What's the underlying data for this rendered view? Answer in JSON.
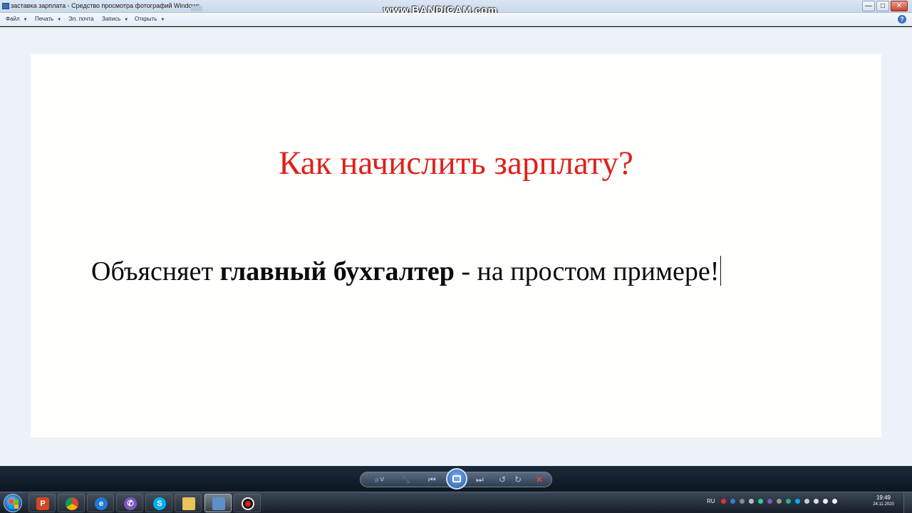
{
  "window": {
    "title": "заставка зарплата - Средство просмотра фотографий Windows",
    "controls": [
      "—",
      "□",
      "✕"
    ]
  },
  "overlay": {
    "watermark": "www.BANDICAM.com"
  },
  "menu": {
    "items": [
      {
        "label": "Файл",
        "has_dropdown": true
      },
      {
        "label": "Печать",
        "has_dropdown": true
      },
      {
        "label": "Эл. почта",
        "has_dropdown": false
      },
      {
        "label": "Запись",
        "has_dropdown": true
      },
      {
        "label": "Открыть",
        "has_dropdown": true
      }
    ],
    "help": "?"
  },
  "photo": {
    "title": "Как начислить зарплату?",
    "subtitle_start": "Объясняет ",
    "subtitle_bold": "главный бухгалтер",
    "subtitle_end": " - на простом примере!",
    "title_color": "#e0201b"
  },
  "viewer_controls": {
    "buttons": [
      "zoom-icon",
      "fit-icon",
      "previous-icon",
      "slideshow-icon",
      "next-icon",
      "rotate-left-icon",
      "rotate-right-icon",
      "delete-icon"
    ]
  },
  "taskbar": {
    "apps": [
      "powerpoint-icon",
      "chrome-icon",
      "internet-explorer-icon",
      "viber-icon",
      "skype-icon",
      "explorer-icon",
      "photo-viewer-icon",
      "bandicam-icon"
    ],
    "language": "RU",
    "time": "19:49",
    "date": "24.11.2020"
  }
}
